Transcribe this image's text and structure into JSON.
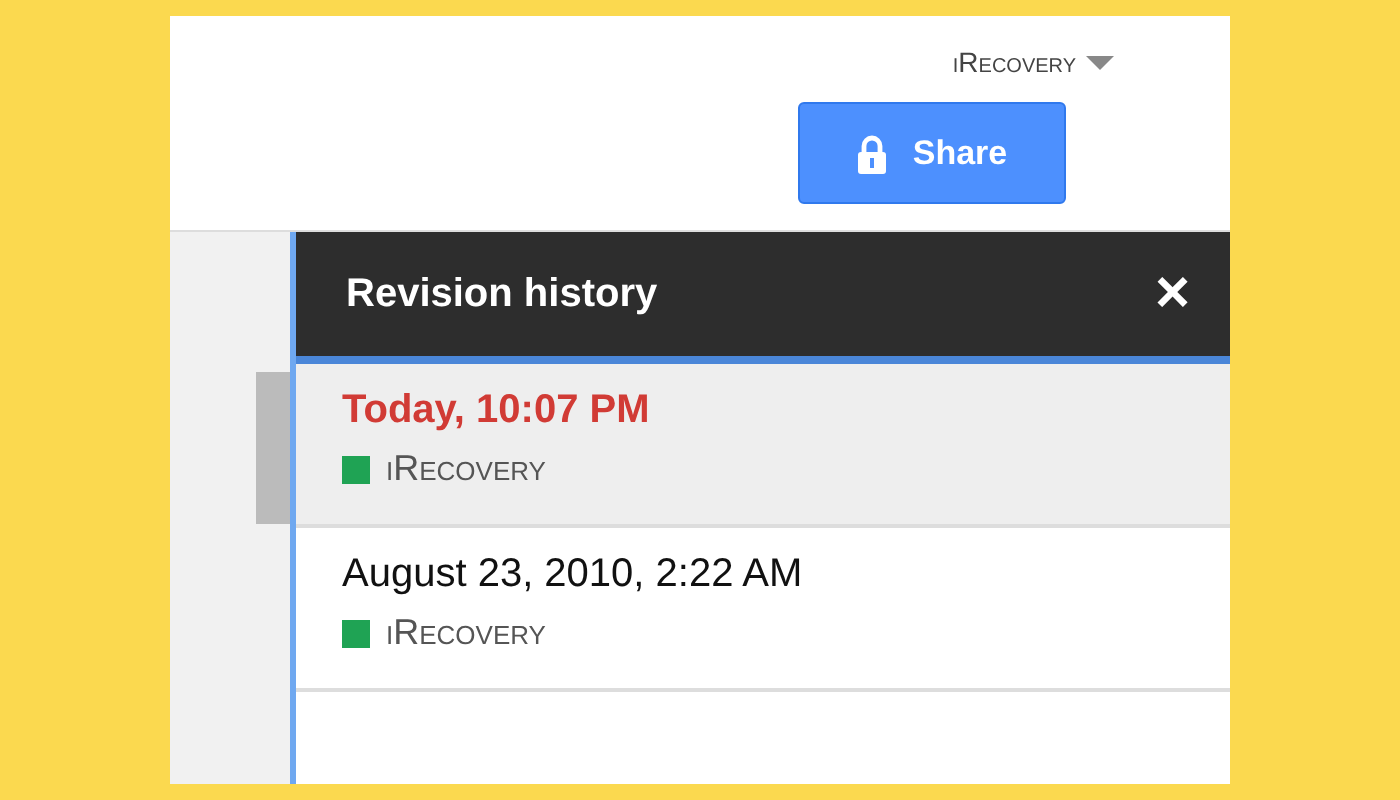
{
  "header": {
    "account": "iRecovery",
    "share_button": "Share"
  },
  "revision_panel": {
    "title": "Revision history",
    "close": "×",
    "revisions": [
      {
        "date": "Today, 10:07 PM",
        "author": "iRecovery",
        "color": "#1fa354",
        "selected": true
      },
      {
        "date": "August 23, 2010, 2:22 AM",
        "author": "iRecovery",
        "color": "#1fa354",
        "selected": false
      }
    ]
  }
}
